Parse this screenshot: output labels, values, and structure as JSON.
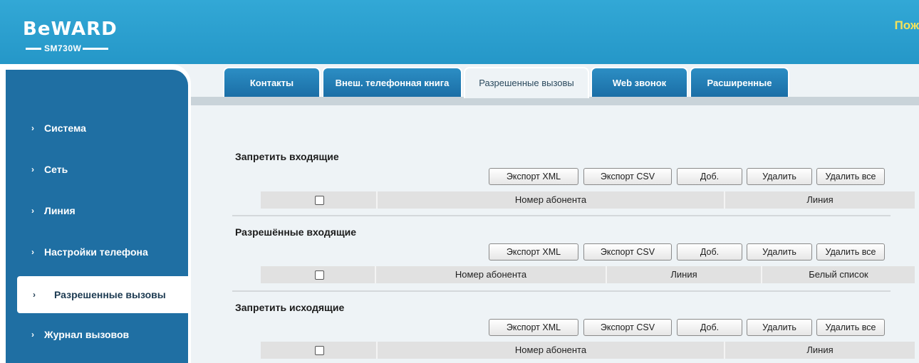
{
  "header": {
    "brand": "BeWARD",
    "model": "SM730W",
    "welcome": "Пож"
  },
  "tabs": [
    {
      "label": "Контакты"
    },
    {
      "label": "Внеш. телефонная книга"
    },
    {
      "label": "Разрешенные вызовы",
      "active": true
    },
    {
      "label": "Web звонок"
    },
    {
      "label": "Расширенные"
    }
  ],
  "sidebar": {
    "items": [
      {
        "label": "Система"
      },
      {
        "label": "Сеть"
      },
      {
        "label": "Линия"
      },
      {
        "label": "Настройки телефона"
      },
      {
        "label": "Разрешенные вызовы",
        "active": true
      },
      {
        "label": "Журнал вызовов"
      }
    ]
  },
  "buttons": {
    "export_xml": "Экспорт XML",
    "export_csv": "Экспорт CSV",
    "add": "Доб.",
    "delete": "Удалить",
    "delete_all": "Удалить все"
  },
  "sections": [
    {
      "title": "Запретить входящие",
      "columns": [
        "Номер абонента",
        "Линия"
      ]
    },
    {
      "title": "Разрешённые входящие",
      "columns": [
        "Номер абонента",
        "Линия",
        "Белый список"
      ]
    },
    {
      "title": "Запретить исходящие",
      "columns": [
        "Номер абонента",
        "Линия"
      ]
    }
  ]
}
